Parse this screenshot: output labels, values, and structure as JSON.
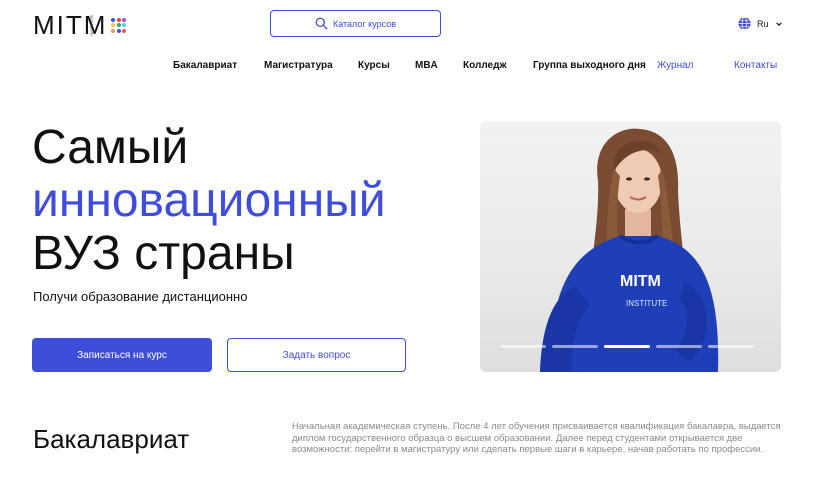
{
  "brand": {
    "logo_text": "MITM",
    "logo_sub": "INSTITUTE",
    "dot_colors": [
      "#3f4ddb",
      "#e84545",
      "#9b51e0",
      "#f2c94c",
      "#27ae60",
      "#56ccf2",
      "#f2994a",
      "#3f4ddb",
      "#eb5757"
    ]
  },
  "header": {
    "search_placeholder": "Каталог курсов",
    "language": "Ru"
  },
  "nav": {
    "items": [
      {
        "label": "Бакалавриат"
      },
      {
        "label": "Магистратура"
      },
      {
        "label": "Курсы"
      },
      {
        "label": "MBA"
      },
      {
        "label": "Колледж"
      },
      {
        "label": "Группа выходного дня"
      },
      {
        "label": "Журнал"
      },
      {
        "label": "Контакты"
      }
    ]
  },
  "hero": {
    "title_line1": "Самый",
    "title_line2": "инновационный",
    "title_line3": "ВУЗ страны",
    "subtitle": "Получи образование дистанционно",
    "primary_button": "Записаться на курс",
    "secondary_button": "Задать вопрос",
    "slider_count": 5,
    "slider_active_index": 2
  },
  "bachelor": {
    "title": "Бакалавриат",
    "description": "Начальная академическая ступень. После 4 лет обучения присваивается квалификация бакалавра, выдается диплом государственного образца о высшем образовании. Далее перед студентами открывается две возможности: перейти в магистратуру или сделать первые шаги в карьере, начав работать по профессии."
  },
  "colors": {
    "accent": "#3f4ddb",
    "text": "#111111",
    "muted": "#8a8a8a"
  }
}
